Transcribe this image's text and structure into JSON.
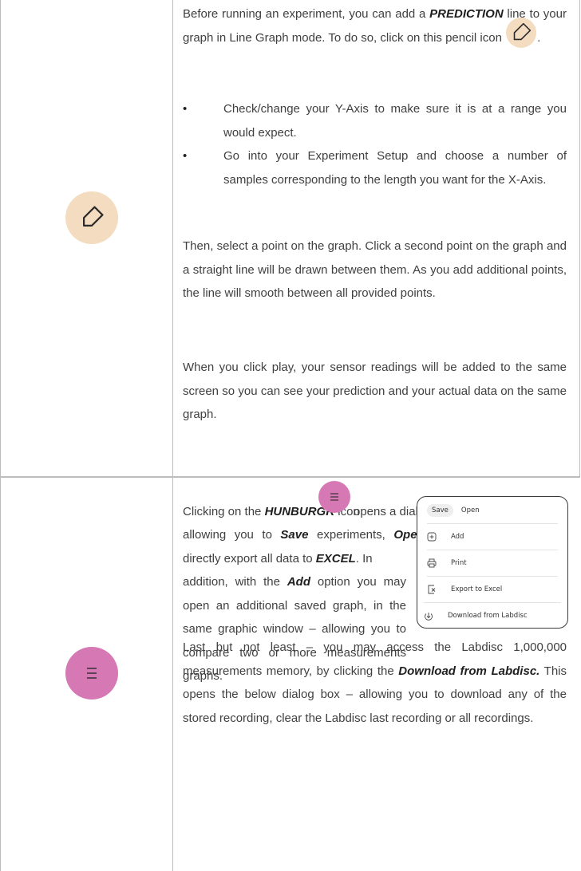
{
  "row1": {
    "icon_name": "pencil-icon",
    "icon_color": "#f3dcbf",
    "para1_pre": "Before running an experiment, you can add a ",
    "para1_bold": "PREDICTION",
    "para1_post": " line to your graph in Line Graph mode. To do so, click on this pencil icon",
    "para1_end": ".",
    "bullets": [
      "Check/change your Y-Axis to make sure it is at a range you would expect.",
      "Go into your Experiment Setup and choose a number of samples corresponding to the length you want for the X-Axis."
    ],
    "para2": "Then, select a point on the graph. Click a second point on the graph and a straight line will be drawn between them. As you add additional points, the line will smooth between all provided points.",
    "para3": "When you click play, your sensor readings will be added to the same screen so you can see your prediction and your actual data on the same graph."
  },
  "row2": {
    "icon_name": "hamburger-menu-icon",
    "icon_color": "#d678b4",
    "p_a": "Clicking on the ",
    "p_b": "HUNBURGR",
    "p_c": " icon",
    "p_d": " opens a dialog box allowing you to ",
    "p_e": "Save",
    "p_f": " experiments, ",
    "p_g": "Open",
    "p_h": " saved experiments and directly export all data to ",
    "p_i": "EXCEL",
    "p_j": ". In addition, with the ",
    "p_k": "Add",
    "p_l": " option you may open an additional saved graph, in the same graphic window – allowing you to compare two or more measurements graphs.",
    "menu": {
      "save": "Save",
      "open": "Open",
      "add": "Add",
      "print": "Print",
      "export": "Export to Excel",
      "download": "Download from Labdisc"
    },
    "q_a": "Last but not least – you may access the Labdisc 1,000,000 measurements memory, by clicking the ",
    "q_b": "Download from Labdisc.",
    "q_c": " This opens the below dialog box – allowing you to download any of the stored recording, clear the Labdisc last recording or all recordings."
  }
}
